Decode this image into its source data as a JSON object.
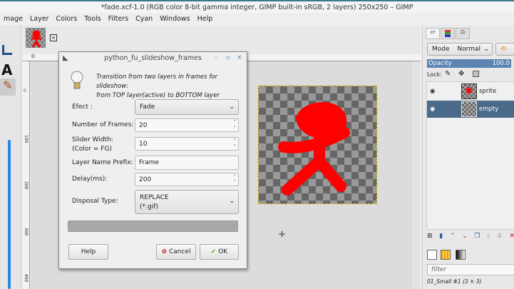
{
  "window_title": "*fade.xcf-1.0 (RGB color 8-bit gamma integer, GIMP built-in sRGB, 2 layers) 250x250 – GIMP",
  "menu": [
    "mage",
    "Layer",
    "Colors",
    "Tools",
    "Filters",
    "Cyan",
    "Windows",
    "Help"
  ],
  "ruler": {
    "h0": "0",
    "v": [
      "0",
      "100",
      "200",
      "300",
      "400"
    ]
  },
  "dialog": {
    "title": "python_fu_slideshow_frames",
    "description_line1": "Transition from two layers in frames for slideshow:",
    "description_line2": "from TOP layer(active) to BOTTOM layer",
    "effect_label": "Efect :",
    "effect_value": "Fade",
    "frames_label": "Number of Frames:",
    "frames_value": "20",
    "slider_label1": "Slider Width:",
    "slider_label2": "(Color = FG)",
    "slider_value": "10",
    "prefix_label": "Layer Name Prefix:",
    "prefix_value": "Frame",
    "delay_label": "Delay(ms):",
    "delay_value": "200",
    "disposal_label": "Disposal Type:",
    "disposal_value1": "REPLACE",
    "disposal_value2": "(*.gif)",
    "progress": 0,
    "help": "Help",
    "cancel": "Cancel",
    "ok": "OK"
  },
  "layers_panel": {
    "mode_label": "Mode",
    "mode_value": "Normal",
    "opacity_label": "Opacity",
    "opacity_value": "100.0",
    "lock_label": "Lock:",
    "layers": [
      {
        "name": "sprite",
        "selected": false
      },
      {
        "name": "empty",
        "selected": true
      }
    ]
  },
  "brushes_panel": {
    "filter_placeholder": "filter",
    "brush_name": "01_Small #1 (3 × 3)"
  },
  "colors": {
    "accent": "#4a6a8a",
    "sprite": "#ff0000"
  }
}
